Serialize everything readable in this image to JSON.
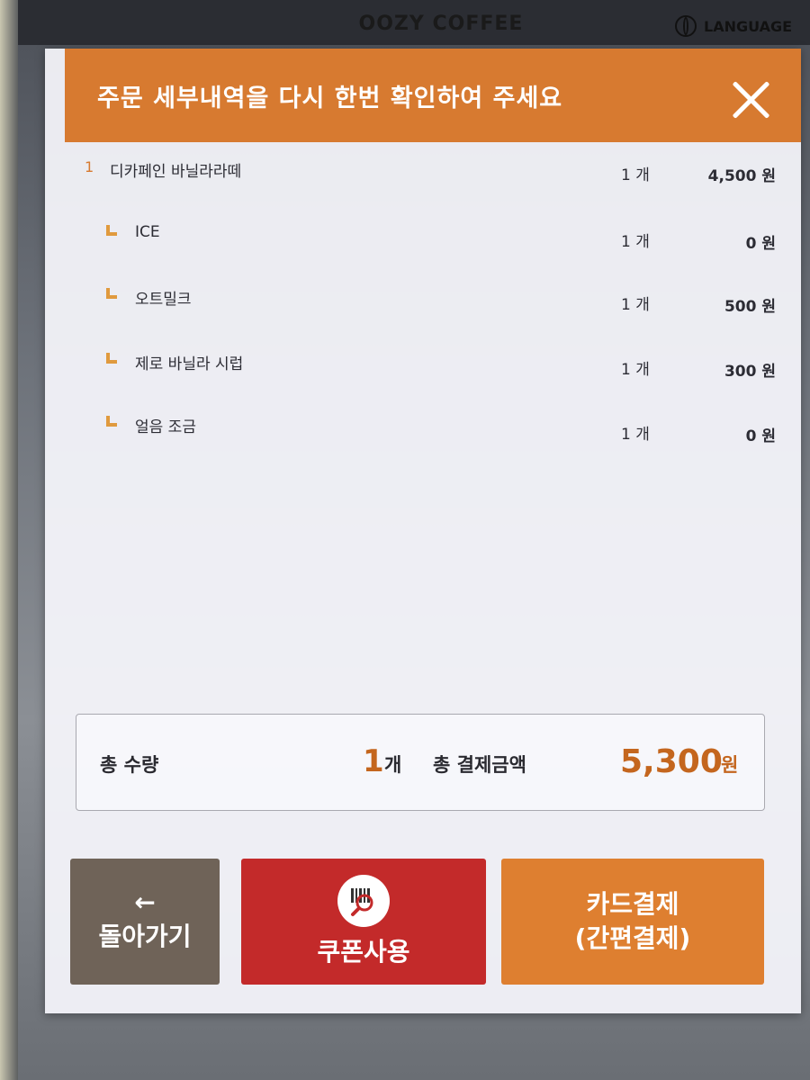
{
  "kiosk": {
    "brand": "OOZY COFFEE",
    "language_label": "LANGUAGE"
  },
  "modal": {
    "title": "주문 세부내역을 다시 한번 확인하여 주세요",
    "items": [
      {
        "index": "1",
        "name": "디카페인 바닐라라떼",
        "qty": "1 개",
        "price": "4,500 원",
        "sub": false
      },
      {
        "index": "",
        "name": "ICE",
        "qty": "1 개",
        "price": "0 원",
        "sub": true
      },
      {
        "index": "",
        "name": "오트밀크",
        "qty": "1 개",
        "price": "500 원",
        "sub": true
      },
      {
        "index": "",
        "name": "제로 바닐라 시럽",
        "qty": "1 개",
        "price": "300 원",
        "sub": true
      },
      {
        "index": "",
        "name": "얼음 조금",
        "qty": "1 개",
        "price": "0 원",
        "sub": true
      }
    ],
    "totals": {
      "qty_label": "총 수량",
      "qty_value": "1",
      "qty_unit": "개",
      "amount_label": "총 결제금액",
      "amount_value": "5,300",
      "amount_unit": "원"
    },
    "buttons": {
      "back_arrow": "←",
      "back_label": "돌아가기",
      "coupon_label": "쿠폰사용",
      "card_line1": "카드결제",
      "card_line2": "(간편결제)"
    }
  },
  "colors": {
    "header": "#d77a30",
    "accent": "#c4661e",
    "coupon": "#c32a2a",
    "back": "#6f6358"
  },
  "icons": {
    "close": "close-icon",
    "coupon": "barcode-search-icon",
    "language": "globe-icon"
  }
}
